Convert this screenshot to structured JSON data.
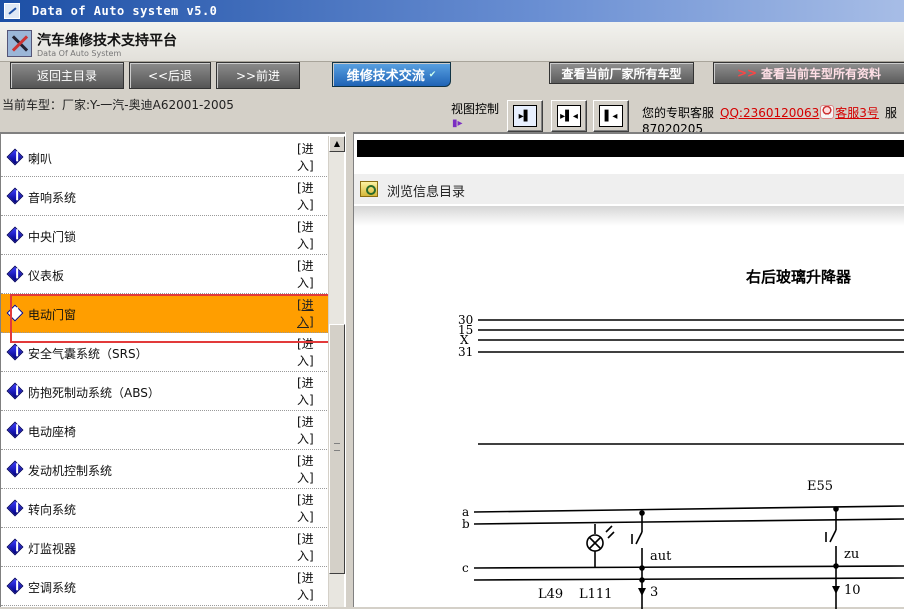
{
  "window": {
    "title": "Data of Auto system v5.0"
  },
  "header": {
    "brand_cn": "汽车维修技术支持平台",
    "brand_en": "Data Of Auto System"
  },
  "navbar": {
    "home": "返回主目录",
    "back": "<<后退",
    "forward": ">>前进",
    "forum": "维修技术交流",
    "brand_all": "查看当前厂家所有车型",
    "model_all": "查看当前车型所有资料"
  },
  "infobar": {
    "current_model": "当前车型：厂家:Y-一汽-奥迪A62001-2005",
    "view_control": "视图控制",
    "support_label": "您的专职客服",
    "qq": "QQ:2360120063",
    "service": "客服3号",
    "more": "服",
    "phone": "87020205"
  },
  "menu": {
    "enter_label": "[进入]",
    "items": [
      {
        "label": "喇叭",
        "active": false
      },
      {
        "label": "音响系统",
        "active": false
      },
      {
        "label": "中央门锁",
        "active": false
      },
      {
        "label": "仪表板",
        "active": false
      },
      {
        "label": "电动门窗",
        "active": true
      },
      {
        "label": "安全气囊系统（SRS）",
        "active": false
      },
      {
        "label": "防抱死制动系统（ABS）",
        "active": false
      },
      {
        "label": "电动座椅",
        "active": false
      },
      {
        "label": "发动机控制系统",
        "active": false
      },
      {
        "label": "转向系统",
        "active": false
      },
      {
        "label": "灯监视器",
        "active": false
      },
      {
        "label": "空调系统",
        "active": false
      }
    ]
  },
  "content": {
    "browse_label": "浏览信息目录",
    "diagram": {
      "title": "右后玻璃升降器",
      "bus_labels": [
        "30",
        "15",
        "X",
        "31"
      ],
      "rail_labels": [
        "a",
        "b",
        "c"
      ],
      "component": "E55",
      "switch_labels": [
        "aut",
        "zu"
      ],
      "wire_labels": [
        "L49",
        "L111"
      ],
      "terminals": [
        "3",
        "10"
      ]
    }
  },
  "colors": {
    "active_row": "#ff9e00",
    "highlight": "#e23a3a",
    "link": "#d40000"
  }
}
